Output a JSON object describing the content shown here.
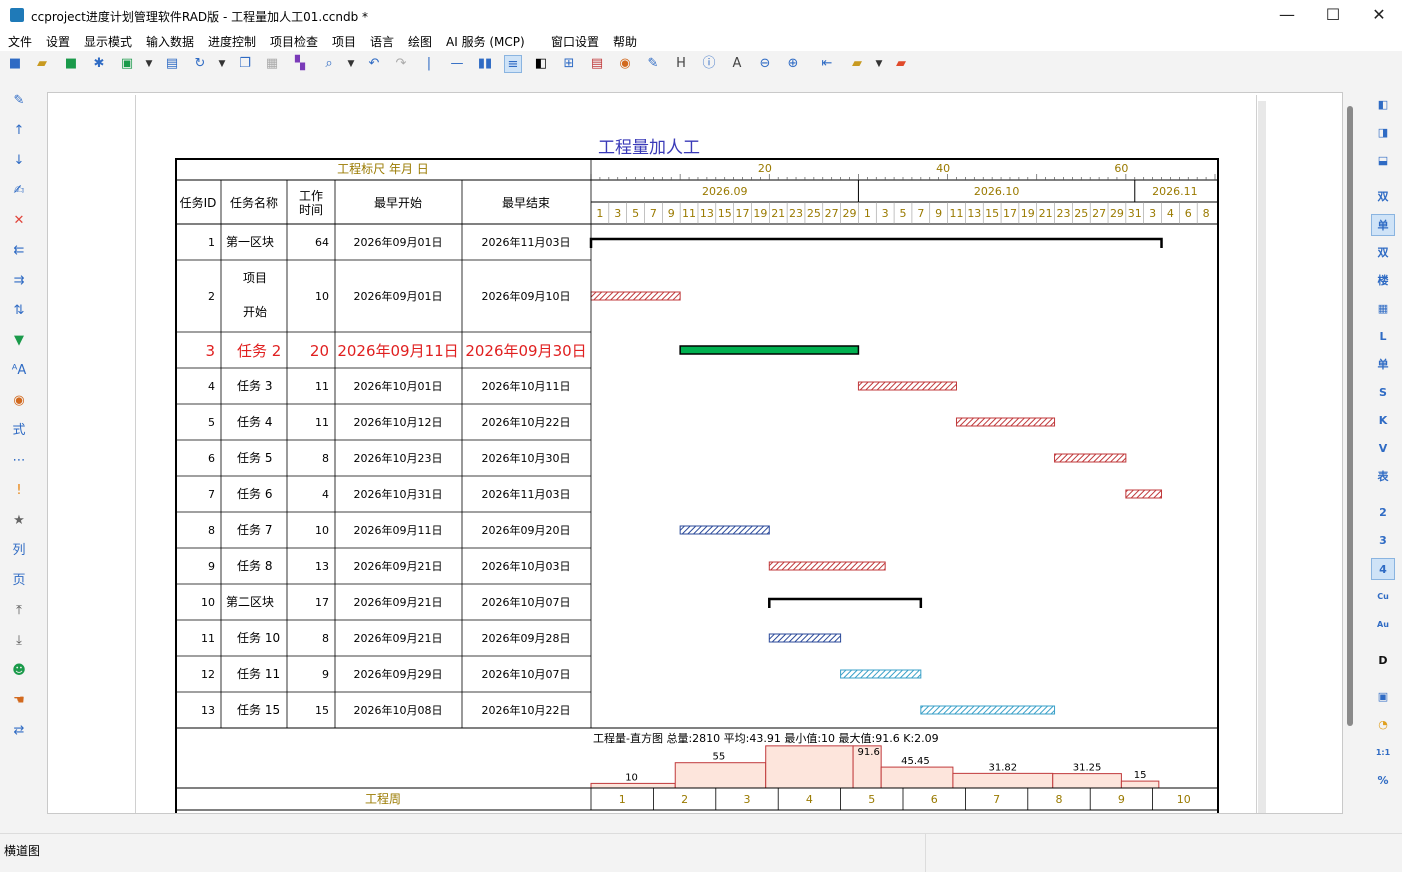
{
  "window": {
    "title": "ccproject进度计划管理软件RAD版 - 工程量加人工01.ccndb *",
    "minimize": "—",
    "maximize": "☐",
    "close": "✕"
  },
  "menu": [
    "文件",
    "设置",
    "显示模式",
    "输入数据",
    "进度控制",
    "项目检查",
    "项目",
    "语言",
    "绘图",
    "AI 服务 (MCP)",
    "窗口设置",
    "帮助"
  ],
  "chart_title": "工程量加人工",
  "ruler": {
    "label": "工程标尺  年月 日",
    "ticks": [
      "20",
      "40",
      "60"
    ]
  },
  "headers": {
    "id": "任务ID",
    "name": "任务名称",
    "dur": "工作时间",
    "start": "最早开始",
    "end": "最早结束"
  },
  "months": [
    "2026.09",
    "2026.10",
    "2026.11"
  ],
  "days": [
    "1",
    "3",
    "5",
    "7",
    "9",
    "11",
    "13",
    "15",
    "17",
    "19",
    "21",
    "23",
    "25",
    "27",
    "29",
    "1",
    "3",
    "5",
    "7",
    "9",
    "11",
    "13",
    "15",
    "17",
    "19",
    "21",
    "23",
    "25",
    "27",
    "29",
    "31",
    "3",
    "4",
    "6",
    "8"
  ],
  "chart_data": {
    "type": "table",
    "tasks": [
      {
        "id": "1",
        "name": "第一区块",
        "dur": "64",
        "start": "2026年09月01日",
        "end": "2026年11月03日",
        "kind": "summary",
        "bar_start": "2026-09-01",
        "bar_end": "2026-11-03",
        "critical": false
      },
      {
        "id": "2",
        "name": "项目开始",
        "dur": "10",
        "start": "2026年09月01日",
        "end": "2026年09月10日",
        "kind": "red",
        "bar_start": "2026-09-01",
        "bar_end": "2026-09-10",
        "critical": false
      },
      {
        "id": "3",
        "name": "任务 2",
        "dur": "20",
        "start": "2026年09月11日",
        "end": "2026年09月30日",
        "kind": "green",
        "bar_start": "2026-09-11",
        "bar_end": "2026-09-30",
        "critical": true
      },
      {
        "id": "4",
        "name": "任务 3",
        "dur": "11",
        "start": "2026年10月01日",
        "end": "2026年10月11日",
        "kind": "red",
        "bar_start": "2026-10-01",
        "bar_end": "2026-10-11",
        "critical": false
      },
      {
        "id": "5",
        "name": "任务 4",
        "dur": "11",
        "start": "2026年10月12日",
        "end": "2026年10月22日",
        "kind": "red",
        "bar_start": "2026-10-12",
        "bar_end": "2026-10-22",
        "critical": false
      },
      {
        "id": "6",
        "name": "任务 5",
        "dur": "8",
        "start": "2026年10月23日",
        "end": "2026年10月30日",
        "kind": "red",
        "bar_start": "2026-10-23",
        "bar_end": "2026-10-30",
        "critical": false
      },
      {
        "id": "7",
        "name": "任务 6",
        "dur": "4",
        "start": "2026年10月31日",
        "end": "2026年11月03日",
        "kind": "red",
        "bar_start": "2026-10-31",
        "bar_end": "2026-11-03",
        "critical": false
      },
      {
        "id": "8",
        "name": "任务 7",
        "dur": "10",
        "start": "2026年09月11日",
        "end": "2026年09月20日",
        "kind": "blue",
        "bar_start": "2026-09-11",
        "bar_end": "2026-09-20",
        "critical": false
      },
      {
        "id": "9",
        "name": "任务 8",
        "dur": "13",
        "start": "2026年09月21日",
        "end": "2026年10月03日",
        "kind": "red",
        "bar_start": "2026-09-21",
        "bar_end": "2026-10-03",
        "critical": false
      },
      {
        "id": "10",
        "name": "第二区块",
        "dur": "17",
        "start": "2026年09月21日",
        "end": "2026年10月07日",
        "kind": "summary",
        "bar_start": "2026-09-21",
        "bar_end": "2026-10-07",
        "critical": false
      },
      {
        "id": "11",
        "name": "任务 10",
        "dur": "8",
        "start": "2026年09月21日",
        "end": "2026年09月28日",
        "kind": "blue",
        "bar_start": "2026-09-21",
        "bar_end": "2026-09-28",
        "critical": false
      },
      {
        "id": "12",
        "name": "任务 11",
        "dur": "9",
        "start": "2026年09月29日",
        "end": "2026年10月07日",
        "kind": "teal",
        "bar_start": "2026-09-29",
        "bar_end": "2026-10-07",
        "critical": false
      },
      {
        "id": "13",
        "name": "任务 15",
        "dur": "15",
        "start": "2026年10月08日",
        "end": "2026年10月22日",
        "kind": "teal",
        "bar_start": "2026-10-08",
        "bar_end": "2026-10-22",
        "critical": false
      }
    ],
    "histogram": {
      "label": "工程量-直方图 总量:2810 平均:43.91 最小值:10 最大值:91.6 K:2.09",
      "values": [
        10,
        55,
        91.6,
        45.45,
        31.82,
        31.25,
        15
      ],
      "value_labels": [
        "10",
        "55",
        "91.6",
        "45.45",
        "31.82",
        "31.25",
        "15"
      ]
    },
    "weeks": {
      "label": "工程周",
      "items": [
        "1",
        "2",
        "3",
        "4",
        "5",
        "6",
        "7",
        "8",
        "9",
        "10"
      ]
    }
  },
  "status": {
    "text": "横道图"
  },
  "colors": {
    "red": "#c0393b",
    "green": "#00b050",
    "blue": "#2b4a9a",
    "teal": "#3aa0c8",
    "ruler_text": "#9a7a00",
    "hist_fill": "#fde5dc",
    "hist_stroke": "#c0393b",
    "title": "#3a3ab8",
    "critical_text": "#e02020"
  }
}
